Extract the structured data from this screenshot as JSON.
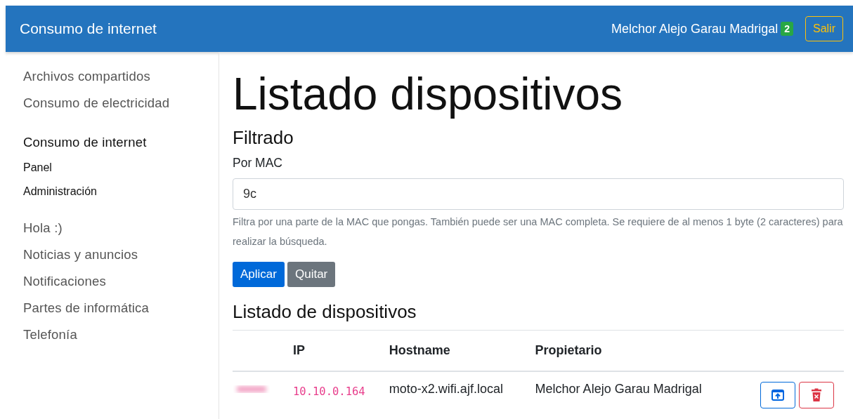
{
  "navbar": {
    "brand": "Consumo de internet",
    "user": "Melchor Alejo Garau Madrigal",
    "badge": "2",
    "logout": "Salir"
  },
  "sidebar": {
    "items": [
      {
        "label": "Archivos compartidos",
        "selected": false
      },
      {
        "label": "Consumo de electricidad",
        "selected": false
      },
      {
        "label": "Consumo de internet",
        "selected": true,
        "children": [
          {
            "label": "Panel"
          },
          {
            "label": "Administración"
          }
        ]
      },
      {
        "label": "Hola :)",
        "selected": false
      },
      {
        "label": "Noticias y anuncios",
        "selected": false
      },
      {
        "label": "Notificaciones",
        "selected": false
      },
      {
        "label": "Partes de informática",
        "selected": false
      },
      {
        "label": "Telefonía",
        "selected": false
      }
    ]
  },
  "main": {
    "title": "Listado dispositivos",
    "filter": {
      "heading": "Filtrado",
      "label": "Por MAC",
      "value": "9c",
      "help": "Filtra por una parte de la MAC que pongas. También puede ser una MAC completa. Se requiere de al menos 1 byte (2 caracteres) para realizar la búsqueda.",
      "buttons": [
        {
          "label": "Aplicar",
          "kind": "primary"
        },
        {
          "label": "Quitar",
          "kind": "secondary"
        }
      ]
    },
    "table": {
      "heading": "Listado de dispositivos",
      "columns": [
        "IP",
        "Hostname",
        "Propietario"
      ],
      "rows": [
        {
          "ip": "10.10.0.164",
          "hostname": "moto-x2.wifi.ajf.local",
          "owner": "Melchor Alejo Garau Madrigal"
        }
      ]
    }
  }
}
